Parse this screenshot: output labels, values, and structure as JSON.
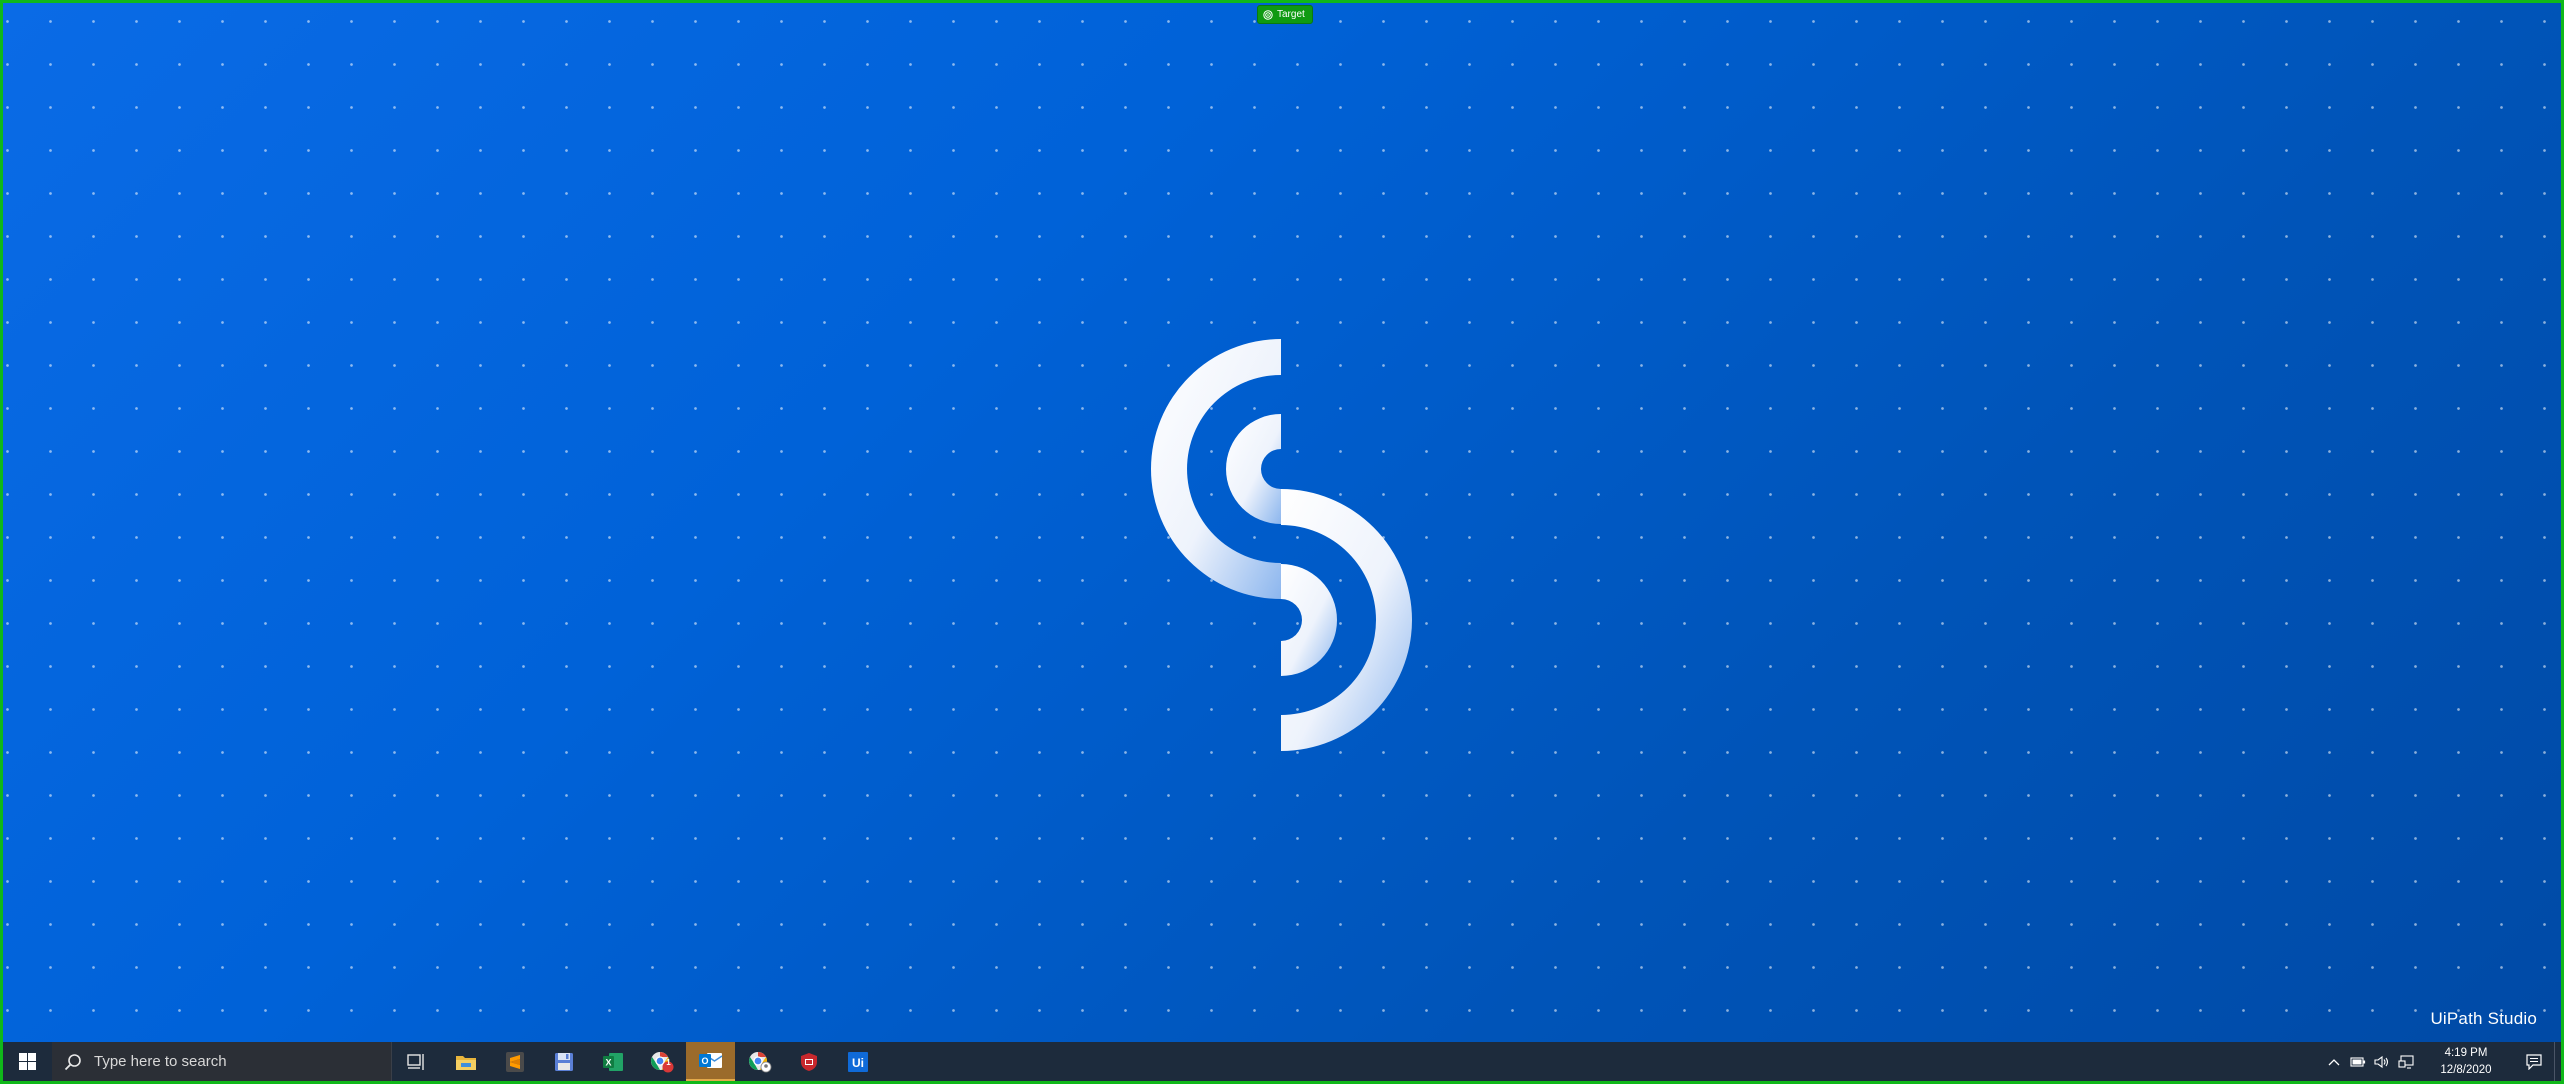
{
  "target_badge": {
    "label": "Target",
    "icon": "target-icon"
  },
  "desktop": {
    "watermark": "UiPath Studio",
    "logo_icon": "uipath-studio-s-logo",
    "background_color": "#0062d8"
  },
  "taskbar": {
    "start_icon": "windows-start-icon",
    "search": {
      "placeholder": "Type here to search",
      "icon": "search-icon"
    },
    "pinned": [
      {
        "name": "task-view",
        "icon": "task-view-icon"
      },
      {
        "name": "file-explorer",
        "icon": "folder-icon"
      },
      {
        "name": "sublime-text",
        "icon": "sublime-text-icon"
      },
      {
        "name": "save-app",
        "icon": "floppy-disk-icon"
      },
      {
        "name": "excel",
        "icon": "excel-icon",
        "letter": "X"
      },
      {
        "name": "chrome-profile",
        "icon": "chrome-profile-icon",
        "badge": "1"
      },
      {
        "name": "outlook",
        "icon": "outlook-icon",
        "letter": "O",
        "active": true
      },
      {
        "name": "chrome",
        "icon": "chrome-icon"
      },
      {
        "name": "shield-app",
        "icon": "shield-icon"
      },
      {
        "name": "uipath",
        "icon": "uipath-icon",
        "letter": "Ui"
      }
    ],
    "tray": {
      "icons": [
        "chevron-up-icon",
        "battery-icon",
        "speaker-icon",
        "network-icon"
      ],
      "time": "4:19 PM",
      "date": "12/8/2020",
      "notification_icon": "notification-icon"
    }
  },
  "colors": {
    "accent_border": "#10b81a",
    "taskbar": "#1d2b3c",
    "active_app": "#9b6b2b"
  }
}
